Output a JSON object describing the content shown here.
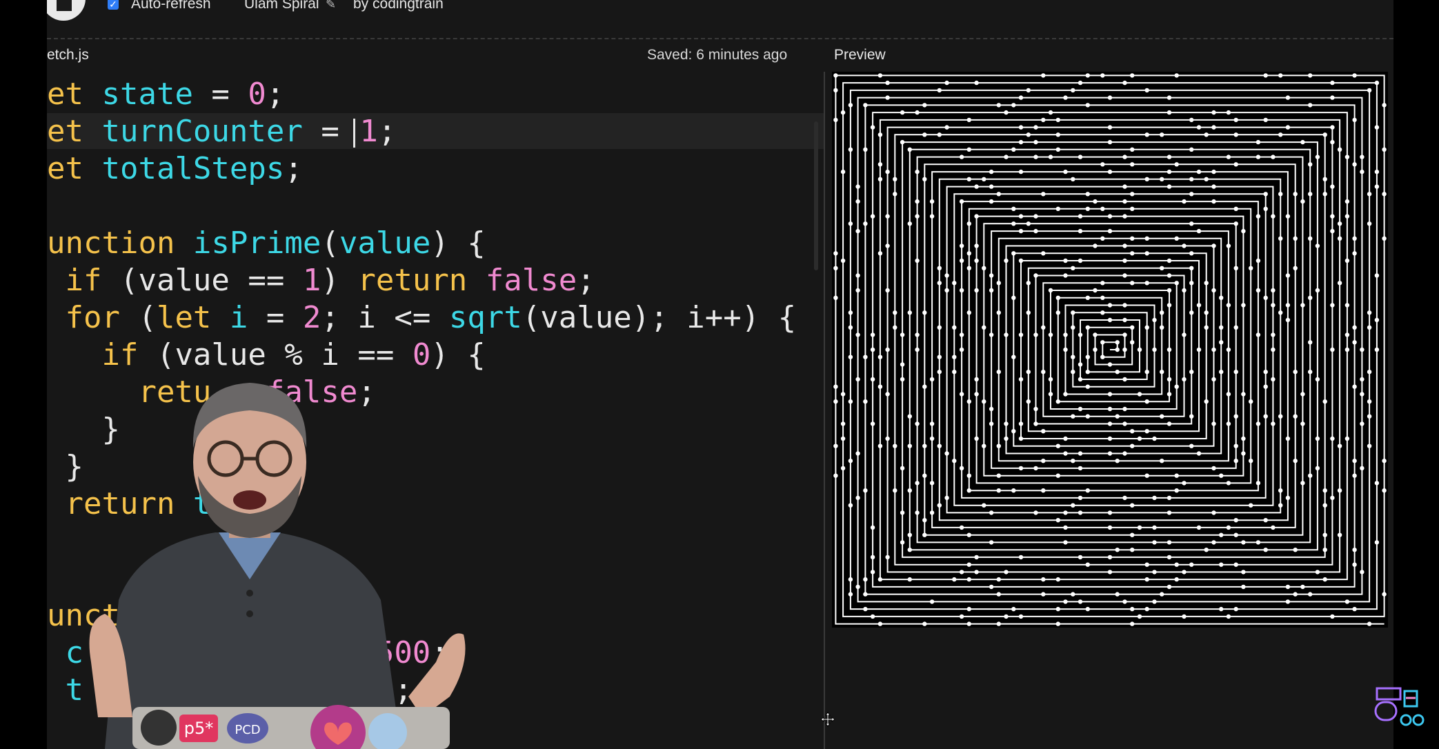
{
  "toolbar": {
    "autorefresh_label": "Auto-refresh",
    "autorefresh_checked": true,
    "sketch_title": "Ulam Spiral",
    "author": "by codingtrain"
  },
  "editor": {
    "file_tab": "etch.js",
    "saved_status": "Saved: 6 minutes ago",
    "preview_label": "Preview"
  },
  "code_lines": [
    [
      {
        "t": "et ",
        "c": "kw"
      },
      {
        "t": "state",
        "c": "id"
      },
      {
        "t": " = ",
        "c": "pl"
      },
      {
        "t": "0",
        "c": "num"
      },
      {
        "t": ";",
        "c": "pl"
      }
    ],
    [
      {
        "t": "et ",
        "c": "kw"
      },
      {
        "t": "turnCounter",
        "c": "id"
      },
      {
        "t": " = ",
        "c": "pl"
      },
      {
        "t": "1",
        "c": "num"
      },
      {
        "t": ";",
        "c": "pl"
      }
    ],
    [
      {
        "t": "et ",
        "c": "kw"
      },
      {
        "t": "totalSteps",
        "c": "id"
      },
      {
        "t": ";",
        "c": "pl"
      }
    ],
    [],
    [
      {
        "t": "unction ",
        "c": "kw"
      },
      {
        "t": "isPrime",
        "c": "id"
      },
      {
        "t": "(",
        "c": "pl"
      },
      {
        "t": "value",
        "c": "id"
      },
      {
        "t": ") {",
        "c": "pl"
      }
    ],
    [
      {
        "t": " if ",
        "c": "kw"
      },
      {
        "t": "(value == ",
        "c": "pl"
      },
      {
        "t": "1",
        "c": "num"
      },
      {
        "t": ") ",
        "c": "pl"
      },
      {
        "t": "return ",
        "c": "kw"
      },
      {
        "t": "false",
        "c": "num"
      },
      {
        "t": ";",
        "c": "pl"
      }
    ],
    [
      {
        "t": " for ",
        "c": "kw"
      },
      {
        "t": "(",
        "c": "pl"
      },
      {
        "t": "let ",
        "c": "kw"
      },
      {
        "t": "i",
        "c": "id"
      },
      {
        "t": " = ",
        "c": "pl"
      },
      {
        "t": "2",
        "c": "num"
      },
      {
        "t": "; i <= ",
        "c": "pl"
      },
      {
        "t": "sqrt",
        "c": "id"
      },
      {
        "t": "(value); i++) {",
        "c": "pl"
      }
    ],
    [
      {
        "t": "   if ",
        "c": "kw"
      },
      {
        "t": "(value % i == ",
        "c": "pl"
      },
      {
        "t": "0",
        "c": "num"
      },
      {
        "t": ") {",
        "c": "pl"
      }
    ],
    [
      {
        "t": "     retu",
        "c": "kw"
      },
      {
        "t": "   ",
        "c": "pl"
      },
      {
        "t": "false",
        "c": "num"
      },
      {
        "t": ";",
        "c": "pl"
      }
    ],
    [
      {
        "t": "   }",
        "c": "pl"
      }
    ],
    [
      {
        "t": " }",
        "c": "pl"
      }
    ],
    [
      {
        "t": " return ",
        "c": "kw"
      },
      {
        "t": "t",
        "c": "id"
      }
    ],
    [],
    [],
    [
      {
        "t": "unct",
        "c": "kw"
      }
    ],
    [
      {
        "t": " c",
        "c": "id"
      },
      {
        "t": "                ",
        "c": "pl"
      },
      {
        "t": "500",
        "c": "num"
      },
      {
        "t": ";",
        "c": "pl"
      }
    ],
    [
      {
        "t": " t",
        "c": "id"
      },
      {
        "t": "                ",
        "c": "pl"
      },
      {
        "t": ");",
        "c": "pl"
      }
    ]
  ],
  "colors": {
    "keyword": "#f5c24b",
    "identifier": "#3dd8e6",
    "number": "#f08ad0",
    "plain": "#e8e8e8",
    "editor_bg": "#171717",
    "accent": "#2f7df6"
  },
  "presenter_badges": [
    "p5*",
    "PCD"
  ],
  "icons": [
    "stop-icon",
    "checkbox-icon",
    "pencil-icon",
    "move-icon",
    "train-logo-icon"
  ]
}
